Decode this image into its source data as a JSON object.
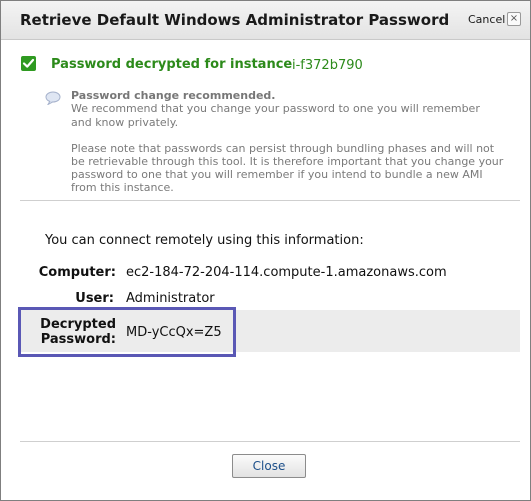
{
  "dialog": {
    "title": "Retrieve Default Windows Administrator Password",
    "cancel_label": "Cancel",
    "close_glyph": "×"
  },
  "success": {
    "message": "Password decrypted for instance",
    "instance_id": "i-f372b790",
    "icon": "checkmark-icon",
    "color": "#2c8a1a"
  },
  "notice": {
    "icon": "speech-bubble-icon",
    "title": "Password change recommended.",
    "line1": "We recommend that you change your password to one you will remember",
    "line2": "and know privately.",
    "line3": "Please note that passwords can persist through bundling phases and will not",
    "line4": "be retrievable through this tool. It is therefore important that you change your",
    "line5": "password to one that you will remember if you intend to bundle a new AMI",
    "line6": "from this instance."
  },
  "connection": {
    "intro": "You can connect remotely using this information:",
    "computer_label": "Computer:",
    "computer_value": "ec2-184-72-204-114.compute-1.amazonaws.com",
    "user_label": "User:",
    "user_value": "Administrator",
    "password_label_line1": "Decrypted",
    "password_label_line2": "Password:",
    "password_value": "MD-yCcQx=Z5",
    "highlight_color": "#5a58b5"
  },
  "footer": {
    "close_label": "Close"
  }
}
